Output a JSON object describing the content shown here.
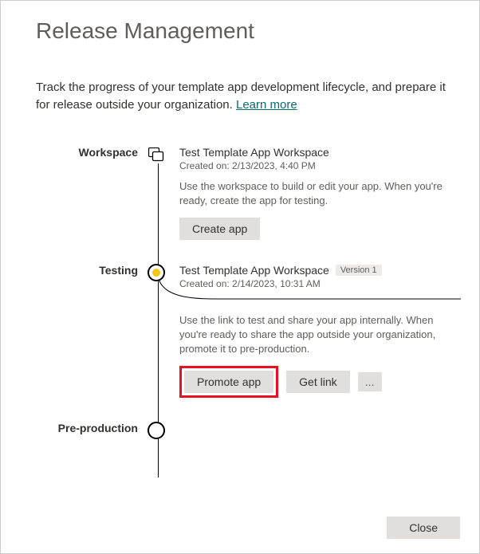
{
  "title": "Release Management",
  "intro": {
    "text": "Track the progress of your template app development lifecycle, and prepare it for release outside your organization. ",
    "learn_more_label": "Learn more"
  },
  "stages": {
    "workspace": {
      "label": "Workspace",
      "title": "Test Template App Workspace",
      "created": "Created on: 2/13/2023, 4:40 PM",
      "desc": "Use the workspace to build or edit your app. When you're ready, create the app for testing.",
      "create_app_label": "Create app"
    },
    "testing": {
      "label": "Testing",
      "title": "Test Template App Workspace",
      "version_badge": "Version 1",
      "created": "Created on: 2/14/2023, 10:31 AM",
      "desc": "Use the link to test and share your app internally. When you're ready to share the app outside your organization, promote it to pre-production.",
      "promote_label": "Promote app",
      "get_link_label": "Get link",
      "more_label": "..."
    },
    "preproduction": {
      "label": "Pre-production"
    }
  },
  "footer": {
    "close_label": "Close"
  }
}
